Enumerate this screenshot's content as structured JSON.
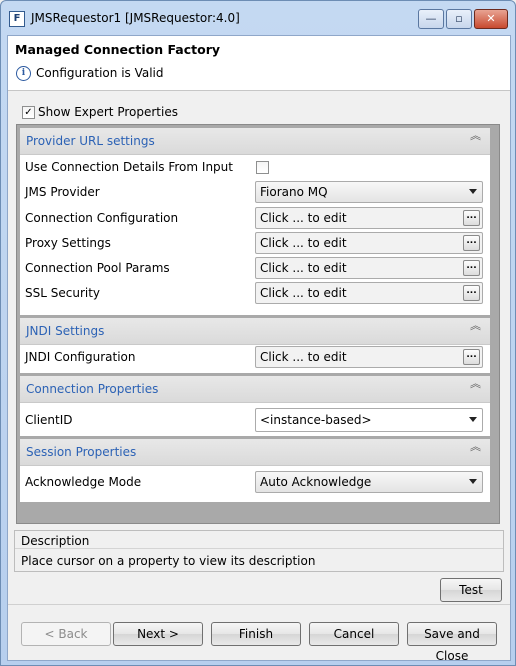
{
  "window": {
    "title": "JMSRequestor1 [JMSRequestor:4.0]",
    "icon_letter": "F",
    "minimize": "—",
    "maximize": "▫",
    "close": "✕"
  },
  "header": {
    "title": "Managed Connection Factory",
    "status": "Configuration is Valid",
    "info_glyph": "i"
  },
  "expert": {
    "label": "Show Expert Properties",
    "checked": true,
    "mark": "✓"
  },
  "sections": {
    "provider": {
      "title": "Provider URL settings",
      "rows": {
        "use_conn": {
          "label": "Use Connection Details From Input"
        },
        "jms_provider": {
          "label": "JMS Provider",
          "value": "Fiorano MQ"
        },
        "conn_config": {
          "label": "Connection Configuration",
          "value": "Click ... to edit"
        },
        "proxy": {
          "label": "Proxy Settings",
          "value": "Click ... to edit"
        },
        "pool": {
          "label": "Connection Pool Params",
          "value": "Click ... to edit"
        },
        "ssl": {
          "label": "SSL Security",
          "value": "Click ... to edit"
        }
      }
    },
    "jndi": {
      "title": "JNDI Settings",
      "rows": {
        "jndi_config": {
          "label": "JNDI Configuration",
          "value": "Click ... to edit"
        }
      }
    },
    "connection": {
      "title": "Connection Properties",
      "rows": {
        "client_id": {
          "label": "ClientID",
          "value": "<instance-based>"
        }
      }
    },
    "session": {
      "title": "Session Properties",
      "rows": {
        "ack": {
          "label": "Acknowledge Mode",
          "value": "Auto Acknowledge"
        }
      }
    }
  },
  "ellipsis": "...",
  "collapse_glyph": "︽",
  "description": {
    "title": "Description",
    "text": "Place cursor on a property to view its description"
  },
  "buttons": {
    "test": "Test",
    "back": "< Back",
    "next": "Next >",
    "finish": "Finish",
    "cancel": "Cancel",
    "save_close": "Save and Close"
  }
}
